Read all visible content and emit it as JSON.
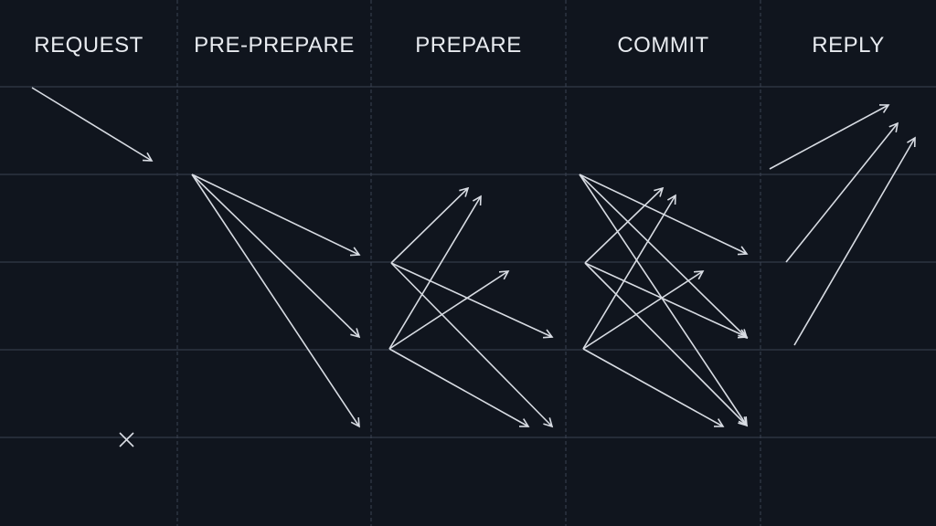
{
  "phases": [
    {
      "label": "REQUEST"
    },
    {
      "label": "PRE-PREPARE"
    },
    {
      "label": "PREPARE"
    },
    {
      "label": "COMMIT"
    },
    {
      "label": "REPLY"
    }
  ],
  "colors": {
    "background": "#10151e",
    "grid": "#3a4252",
    "arrow": "#d8dce3",
    "text": "#e8ebf0"
  },
  "faulty_replica_marker": "x-icon"
}
